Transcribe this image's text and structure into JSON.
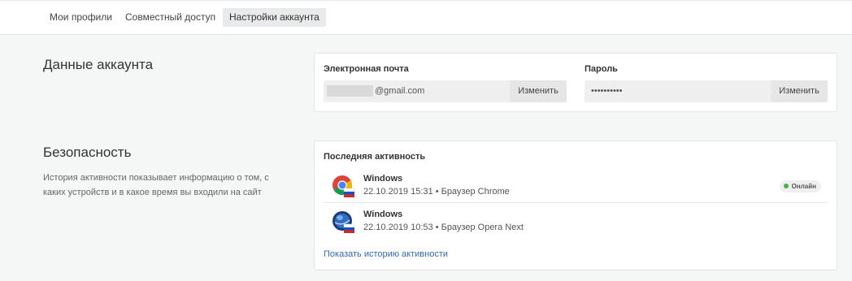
{
  "nav": {
    "tabs": [
      {
        "label": "Мои профили"
      },
      {
        "label": "Совместный доступ"
      },
      {
        "label": "Настройки аккаунта"
      }
    ]
  },
  "account": {
    "title": "Данные аккаунта",
    "email": {
      "label": "Электронная почта",
      "value": "@gmail.com",
      "button": "Изменить"
    },
    "password": {
      "label": "Пароль",
      "value": "••••••••••",
      "button": "Изменить"
    }
  },
  "security": {
    "title": "Безопасность",
    "description": "История активности показывает информацию о том, с каких устройств и в какое время вы входили на сайт",
    "activity_title": "Последняя активность",
    "sessions": [
      {
        "os": "Windows",
        "meta": "22.10.2019 15:31 • Браузер Chrome",
        "status": "Онлайн",
        "browser_icon": "chrome-icon"
      },
      {
        "os": "Windows",
        "meta": "22.10.2019 10:53 • Браузер Opera Next",
        "browser_icon": "opera-next-icon"
      }
    ],
    "history_link": "Показать историю активности"
  },
  "colors": {
    "link": "#3468b3",
    "online": "#4caf50",
    "active_tab_bg": "#e9eaeb"
  }
}
